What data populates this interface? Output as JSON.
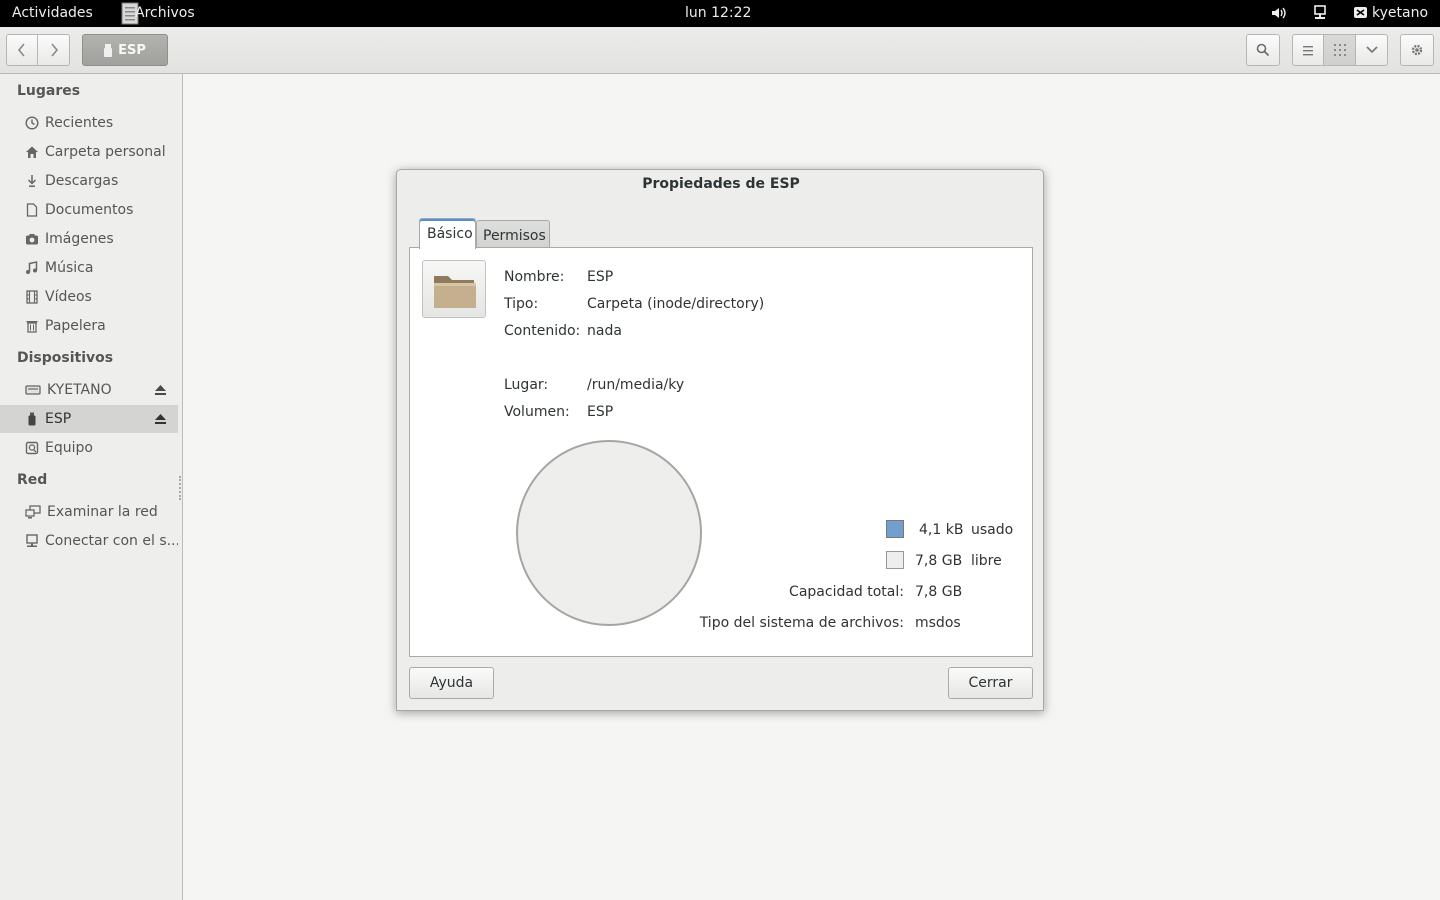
{
  "topbar": {
    "activities": "Actividades",
    "app_name": "Archivos",
    "clock": "lun 12:22",
    "username": "kyetano"
  },
  "toolbar": {
    "path_label": "ESP",
    "icons": [
      "back-icon",
      "forward-icon",
      "search-icon",
      "list-view-icon",
      "grid-view-icon",
      "chevron-down-icon",
      "gear-icon"
    ],
    "active_view": "grid"
  },
  "sidebar": {
    "sections": [
      {
        "heading": "Lugares",
        "items": [
          {
            "label": "Recientes",
            "icon": "clock-icon"
          },
          {
            "label": "Carpeta personal",
            "icon": "home-icon"
          },
          {
            "label": "Descargas",
            "icon": "download-icon"
          },
          {
            "label": "Documentos",
            "icon": "document-icon"
          },
          {
            "label": "Imágenes",
            "icon": "camera-icon"
          },
          {
            "label": "Música",
            "icon": "music-icon"
          },
          {
            "label": "Vídeos",
            "icon": "film-icon"
          },
          {
            "label": "Papelera",
            "icon": "trash-icon"
          }
        ]
      },
      {
        "heading": "Dispositivos",
        "items": [
          {
            "label": "KYETANO",
            "icon": "drive-icon",
            "eject": true
          },
          {
            "label": "ESP",
            "icon": "usb-icon",
            "eject": true,
            "selected": true
          },
          {
            "label": "Equipo",
            "icon": "computer-icon"
          }
        ]
      },
      {
        "heading": "Red",
        "items": [
          {
            "label": "Examinar la red",
            "icon": "network-icon"
          },
          {
            "label": "Conectar con el s...",
            "icon": "server-icon"
          }
        ]
      }
    ]
  },
  "dialog": {
    "title": "Propiedades de ESP",
    "tabs": [
      {
        "label": "Básico",
        "active": true
      },
      {
        "label": "Permisos",
        "active": false
      }
    ],
    "fields": {
      "nombre_label": "Nombre:",
      "nombre": "ESP",
      "tipo_label": "Tipo:",
      "tipo": "Carpeta (inode/directory)",
      "contenido_label": "Contenido:",
      "contenido": "nada",
      "lugar_label": "Lugar:",
      "lugar": "/run/media/ky",
      "volumen_label": "Volumen:",
      "volumen": "ESP"
    },
    "usage": {
      "used_value": "4,1 kB",
      "used_label": "usado",
      "used_color": "#729fcf",
      "free_value": "7,8 GB",
      "free_label": "libre",
      "free_color": "#eeeeec",
      "total_label": "Capacidad total:",
      "total_value": "7,8 GB",
      "fs_label": "Tipo del sistema de archivos:",
      "fs_value": "msdos"
    },
    "buttons": {
      "help": "Ayuda",
      "close": "Cerrar"
    }
  }
}
